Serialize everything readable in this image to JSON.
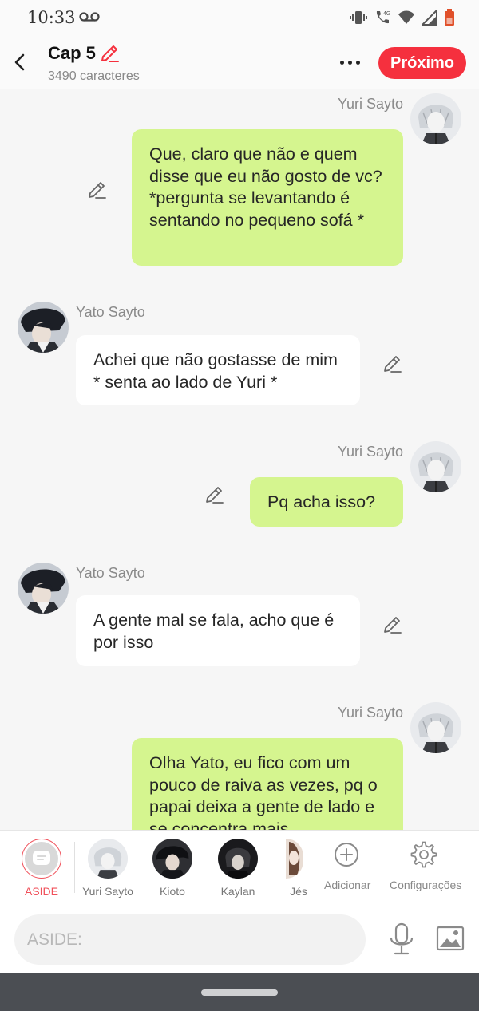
{
  "status_bar": {
    "time": "10:33",
    "network": "4G"
  },
  "header": {
    "chapter_title": "Cap 5",
    "char_count": "3490 caracteres",
    "next_label": "Próximo",
    "accent_color": "#f5303e"
  },
  "messages": [
    {
      "author": "Yuri Sayto",
      "side": "right",
      "text": "Que, claro que não e quem disse que eu não gosto de vc? *pergunta se levantando é sentando no pequeno sofá *"
    },
    {
      "author": "Yato Sayto",
      "side": "left",
      "text": "Achei que não gostasse de mim * senta ao lado de Yuri *"
    },
    {
      "author": "Yuri Sayto",
      "side": "right",
      "text": "Pq acha isso?"
    },
    {
      "author": "Yato Sayto",
      "side": "left",
      "text": "A gente mal se fala, acho que é por isso"
    },
    {
      "author": "Yuri Sayto",
      "side": "right",
      "text": "Olha Yato, eu fico com um pouco de raiva as vezes, pq o papai deixa a gente de lado e se concentra mais"
    }
  ],
  "character_bar": {
    "aside_label": "ASIDE",
    "characters": [
      "Yuri Sayto",
      "Kioto",
      "Kaylan",
      "Jés"
    ],
    "add_label": "Adicionar",
    "settings_label": "Configurações"
  },
  "input": {
    "placeholder": "ASIDE:"
  },
  "colors": {
    "right_bubble": "#d5f58f",
    "left_bubble": "#ffffff",
    "background": "#f6f6f6"
  }
}
